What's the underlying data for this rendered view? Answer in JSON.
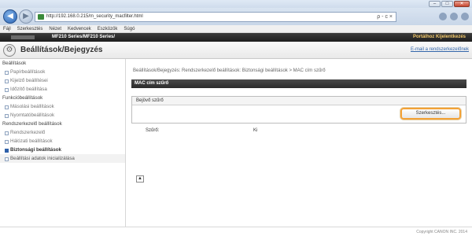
{
  "browser": {
    "address": "http://192.168.0.215/m_security_macfilter.html",
    "address_tools": "ρ - c ×",
    "menu": [
      "Fájl",
      "Szerkesztés",
      "Nézet",
      "Kedvencek",
      "Eszközök",
      "Súgó"
    ]
  },
  "app": {
    "model": "MF210 Series/MF210 Series/",
    "top_links": "Portálhoz  Kijelentkezés",
    "section_title": "Beállítások/Bejegyzés",
    "email_link": "E-mail a rendszerkezelőnek"
  },
  "sidebar": [
    {
      "type": "group",
      "label": "Beállítások"
    },
    {
      "type": "item",
      "label": "Papírbeállítások"
    },
    {
      "type": "item",
      "label": "Kijelző beállítései"
    },
    {
      "type": "item",
      "label": "Időzítő beállítása"
    },
    {
      "type": "group",
      "label": "Funkcióbeállítások"
    },
    {
      "type": "item",
      "label": "Másolási beállítások"
    },
    {
      "type": "item",
      "label": "Nyomtatóbeállítások"
    },
    {
      "type": "group",
      "label": "Rendszerkezelő beállítások"
    },
    {
      "type": "item",
      "label": "Rendszerkezelő"
    },
    {
      "type": "item",
      "label": "Hálózati beállítások"
    },
    {
      "type": "item",
      "label": "Biztonsági beállítások",
      "active": true
    },
    {
      "type": "item",
      "label": "Beállítási adatok inicializálása",
      "highlight": true
    }
  ],
  "content": {
    "breadcrumb": "Beállítások/Bejegyzés: Rendszerkezelő beállítások: Biztonsági beállítások > MAC cím szűrő",
    "panel_title": "MAC cím szűrő",
    "filter_head": "Bejövő szűrő",
    "edit_button": "Szerkesztés...",
    "filter_label": "Szűrő:",
    "filter_value": "Ki",
    "top_icon": "▲"
  },
  "footer": {
    "copyright": "Copyright CANON INC. 2014"
  }
}
